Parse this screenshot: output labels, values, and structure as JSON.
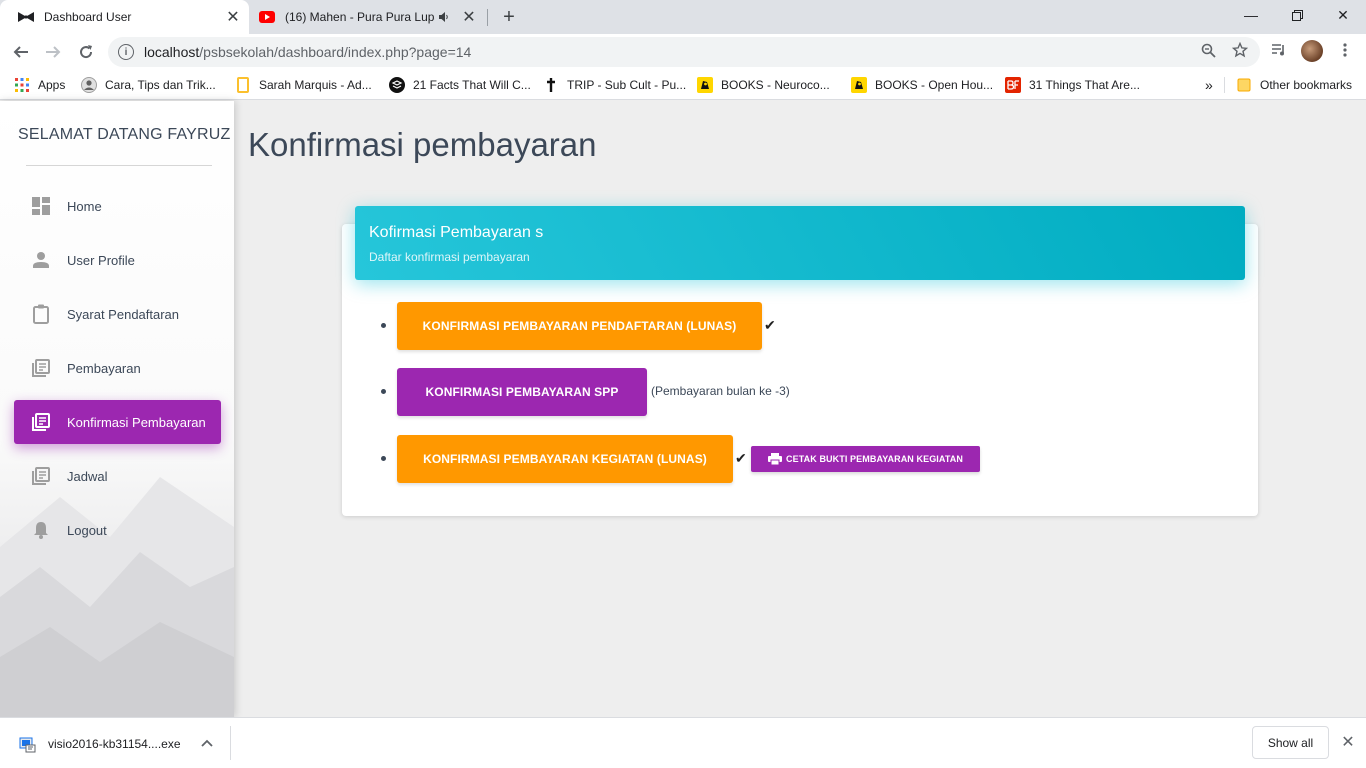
{
  "browser": {
    "tabs": [
      {
        "title": "Dashboard User",
        "favicon": "bow-tie-icon",
        "active": true
      },
      {
        "title": "(16) Mahen - Pura Pura Lupa",
        "favicon": "youtube-icon",
        "active": false
      }
    ],
    "url": {
      "host": "localhost",
      "path": "/psbsekolah/dashboard/index.php?page=14"
    },
    "bookmarks": [
      {
        "label": "Apps",
        "icon": "apps-grid-icon"
      },
      {
        "label": "Cara, Tips dan Trik...",
        "icon": "bookmark-favicon"
      },
      {
        "label": "Sarah Marquis - Ad...",
        "icon": "bookmark-favicon"
      },
      {
        "label": "21 Facts That Will C...",
        "icon": "bookmark-favicon"
      },
      {
        "label": "TRIP - Sub Cult - Pu...",
        "icon": "bookmark-favicon"
      },
      {
        "label": "BOOKS - Neuroco...",
        "icon": "bookmark-favicon"
      },
      {
        "label": "BOOKS - Open Hou...",
        "icon": "bookmark-favicon"
      },
      {
        "label": "31 Things That Are...",
        "icon": "bookmark-favicon"
      }
    ],
    "bookmarks_overflow": "»",
    "other_bookmarks": "Other bookmarks"
  },
  "sidebar": {
    "brand": "SELAMAT DATANG FAYRUZ",
    "items": [
      {
        "label": "Home",
        "icon": "dashboard-icon",
        "active": false
      },
      {
        "label": "User Profile",
        "icon": "person-icon",
        "active": false
      },
      {
        "label": "Syarat Pendaftaran",
        "icon": "clipboard-icon",
        "active": false
      },
      {
        "label": "Pembayaran",
        "icon": "library-books-icon",
        "active": false
      },
      {
        "label": "Konfirmasi Pembayaran",
        "icon": "library-books-icon",
        "active": true
      },
      {
        "label": "Jadwal",
        "icon": "library-books-icon",
        "active": false
      },
      {
        "label": "Logout",
        "icon": "bell-icon",
        "active": false
      }
    ]
  },
  "main": {
    "page_title": "Konfirmasi pembayaran",
    "card": {
      "title": "Kofirmasi Pembayaran s",
      "subtitle": "Daftar konfirmasi pembayaran",
      "items": [
        {
          "label": "KONFIRMASI PEMBAYARAN PENDAFTARAN (LUNAS)",
          "color": "orange",
          "status": "check-icon"
        },
        {
          "label": "KONFIRMASI PEMBAYARAN SPP",
          "color": "purple",
          "note": "(Pembayaran bulan ke -3)"
        },
        {
          "label": "KONFIRMASI PEMBAYARAN KEGIATAN (LUNAS)",
          "color": "orange",
          "status": "check-icon"
        }
      ],
      "print_button": "CETAK BUKTI PEMBAYARAN KEGIATAN"
    }
  },
  "download_bar": {
    "file": "visio2016-kb31154....exe",
    "show_all": "Show all"
  },
  "colors": {
    "primary_purple": "#9c27b0",
    "warning_orange": "#ff9800",
    "header_cyan": "#00acc1"
  }
}
